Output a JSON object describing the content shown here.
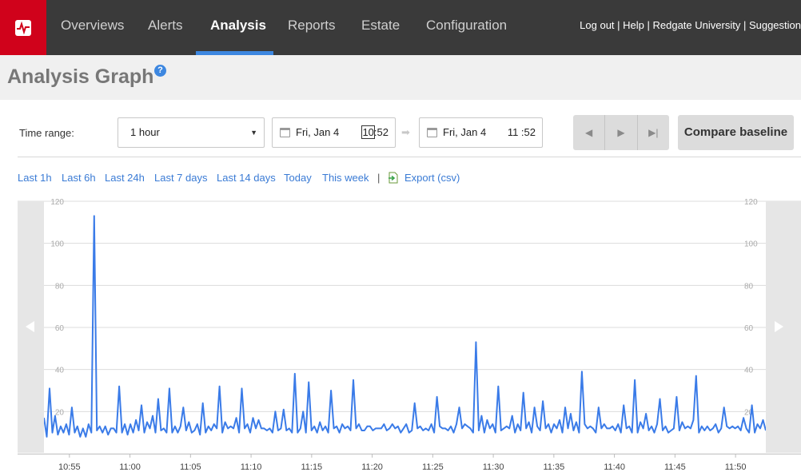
{
  "nav": {
    "items": [
      {
        "label": "Overviews",
        "active": false
      },
      {
        "label": "Alerts",
        "active": false
      },
      {
        "label": "Analysis",
        "active": true
      },
      {
        "label": "Reports",
        "active": false
      },
      {
        "label": "Estate",
        "active": false
      },
      {
        "label": "Configuration",
        "active": false
      }
    ],
    "links": [
      "Log out",
      "Help",
      "Redgate University",
      "Suggestion"
    ],
    "link_separator": " | "
  },
  "page": {
    "title": "Analysis Graph",
    "help_glyph": "?"
  },
  "time_range": {
    "label": "Time range:",
    "selected": "1 hour",
    "start_date": "Fri, Jan 4",
    "start_hour": "10",
    "start_minute": ":52",
    "end_date": "Fri, Jan 4",
    "end_time": "11 :52"
  },
  "buttons": {
    "compare_baseline": "Compare baseline"
  },
  "quick_links": [
    "Last 1h",
    "Last 6h",
    "Last 24h",
    "Last 7 days",
    "Last 14 days",
    "Today",
    "This week"
  ],
  "quick_link_separator": "|",
  "export_label": "Export (csv)",
  "colors": {
    "brand": "#d0021b",
    "accent": "#3d87e0",
    "line": "#3a7be8",
    "topbar": "#3a3a3a"
  },
  "chart_data": {
    "type": "line",
    "title": "",
    "xlabel": "",
    "ylabel": "",
    "ylim": [
      0,
      120
    ],
    "yticks": [
      20,
      40,
      60,
      80,
      100,
      120
    ],
    "x_tick_labels": [
      "10:55",
      "11:00",
      "11:05",
      "11:10",
      "11:15",
      "11:20",
      "11:25",
      "11:30",
      "11:35",
      "11:40",
      "11:45",
      "11:50"
    ],
    "x_start_minute": 52.9,
    "x_end_minute": 112.5,
    "grid": true,
    "series": [
      {
        "values": [
          17,
          8,
          31,
          10,
          18,
          9,
          13,
          10,
          14,
          9,
          22,
          10,
          13,
          8,
          12,
          8,
          14,
          10,
          113,
          11,
          13,
          10,
          13,
          9,
          12,
          12,
          10,
          32,
          10,
          14,
          9,
          14,
          10,
          16,
          11,
          23,
          10,
          15,
          12,
          18,
          10,
          26,
          11,
          12,
          10,
          31,
          10,
          13,
          10,
          13,
          22,
          11,
          15,
          10,
          11,
          14,
          9,
          24,
          10,
          13,
          11,
          14,
          12,
          32,
          10,
          15,
          12,
          13,
          12,
          17,
          10,
          31,
          12,
          14,
          10,
          17,
          12,
          16,
          12,
          12,
          11,
          12,
          10,
          20,
          11,
          12,
          21,
          11,
          12,
          10,
          38,
          10,
          12,
          20,
          10,
          34,
          11,
          13,
          10,
          15,
          11,
          13,
          10,
          30,
          12,
          13,
          10,
          14,
          12,
          13,
          11,
          35,
          12,
          14,
          11,
          11,
          13,
          13,
          11,
          12,
          12,
          12,
          14,
          11,
          12,
          14,
          12,
          13,
          10,
          12,
          14,
          10,
          11,
          24,
          12,
          13,
          11,
          12,
          11,
          14,
          10,
          27,
          13,
          12,
          12,
          11,
          13,
          10,
          14,
          22,
          12,
          14,
          13,
          12,
          10,
          53,
          11,
          18,
          10,
          16,
          12,
          14,
          10,
          32,
          11,
          12,
          13,
          12,
          18,
          10,
          14,
          11,
          29,
          12,
          15,
          10,
          22,
          13,
          11,
          25,
          12,
          14,
          10,
          14,
          12,
          16,
          10,
          22,
          12,
          19,
          11,
          15,
          10,
          39,
          14,
          12,
          13,
          12,
          10,
          22,
          12,
          14,
          12,
          12,
          13,
          11,
          14,
          10,
          23,
          12,
          13,
          10,
          35,
          10,
          15,
          12,
          19,
          11,
          13,
          10,
          14,
          26,
          11,
          13,
          10,
          11,
          12,
          27,
          11,
          15,
          12,
          13,
          12,
          16,
          37,
          10,
          13,
          11,
          13,
          11,
          12,
          14,
          10,
          12,
          22,
          13,
          12,
          13,
          12,
          13,
          11,
          17,
          12,
          10,
          23,
          10,
          14,
          12,
          16,
          11
        ]
      }
    ]
  }
}
